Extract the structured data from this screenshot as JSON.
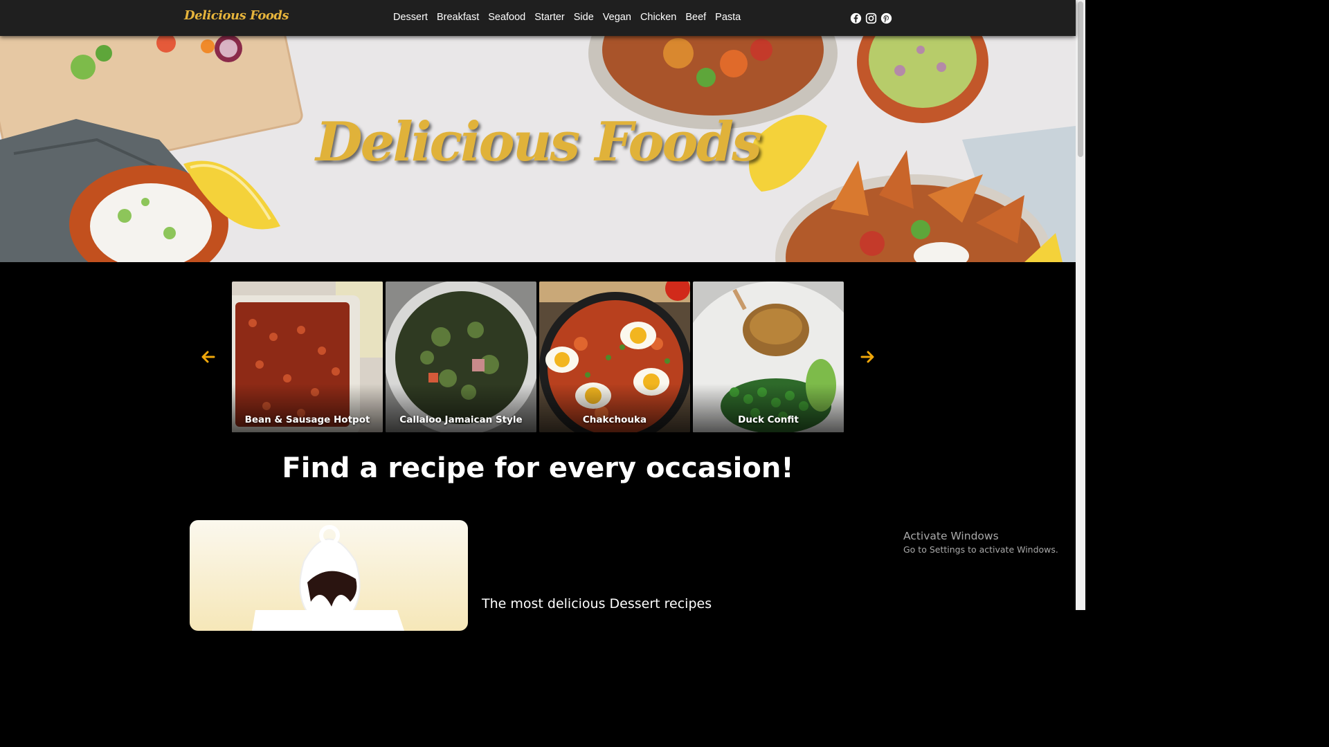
{
  "nav": {
    "brand": "Delicious Foods",
    "links": [
      "Dessert",
      "Breakfast",
      "Seafood",
      "Starter",
      "Side",
      "Vegan",
      "Chicken",
      "Beef",
      "Pasta"
    ],
    "social_icons": [
      "facebook-icon",
      "instagram-icon",
      "pinterest-icon"
    ]
  },
  "hero": {
    "title": "Delicious Foods"
  },
  "carousel": {
    "items": [
      {
        "caption": "Bean & Sausage Hotpot"
      },
      {
        "caption": "Callaloo Jamaican Style"
      },
      {
        "caption": "Chakchouka"
      },
      {
        "caption": "Duck Confit"
      }
    ],
    "arrow_color": "#f0a70a"
  },
  "tagline": "Find a recipe for every occasion!",
  "feature": {
    "text": "The most delicious Dessert recipes"
  },
  "os_overlay": {
    "title": "Activate Windows",
    "subtitle": "Go to Settings to activate Windows."
  },
  "colors": {
    "brand": "#e0b23a",
    "nav_bg": "#1f1f1f",
    "page_bg": "#000000"
  }
}
